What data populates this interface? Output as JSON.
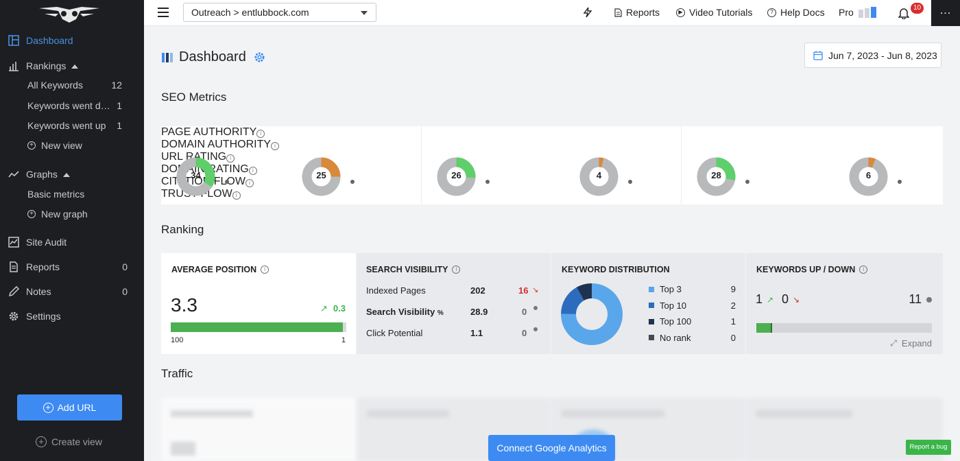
{
  "sidebar": {
    "dashboard": "Dashboard",
    "rankings": "Rankings",
    "rankings_items": [
      {
        "label": "All Keywords",
        "count": "12"
      },
      {
        "label": "Keywords went down",
        "count": "1"
      },
      {
        "label": "Keywords went up",
        "count": "1"
      }
    ],
    "new_view": "New view",
    "graphs": "Graphs",
    "basic_metrics": "Basic metrics",
    "new_graph": "New graph",
    "site_audit": "Site Audit",
    "reports": "Reports",
    "reports_count": "0",
    "notes": "Notes",
    "notes_count": "0",
    "settings": "Settings",
    "add_url": "Add URL",
    "create_view": "Create view"
  },
  "topbar": {
    "project": "Outreach > entlubbock.com",
    "reports": "Reports",
    "video_tutorials": "Video Tutorials",
    "help_docs": "Help Docs",
    "pro": "Pro",
    "notifications": "10",
    "more": "..."
  },
  "page": {
    "title": "Dashboard",
    "date_range": "Jun 7, 2023 - Jun 8, 2023"
  },
  "seo_metrics": {
    "title": "SEO Metrics",
    "items": [
      {
        "label": "PAGE AUTHORITY",
        "value": "34",
        "color": "#5ecf6a"
      },
      {
        "label": "DOMAIN AUTHORITY",
        "value": "25",
        "color": "#d9893a"
      },
      {
        "label": "URL RATING",
        "value": "26",
        "color": "#5ecf6a"
      },
      {
        "label": "DOMAIN RATING",
        "value": "4",
        "color": "#d9893a"
      },
      {
        "label": "CITATION FLOW",
        "value": "28",
        "color": "#5ecf6a"
      },
      {
        "label": "TRUST FLOW",
        "value": "6",
        "color": "#d9893a"
      }
    ]
  },
  "ranking": {
    "title": "Ranking",
    "average_position": {
      "label": "AVERAGE POSITION",
      "value": "3.3",
      "change": "0.3",
      "scale_min": "100",
      "scale_max": "1",
      "fill": 0.98
    },
    "search_visibility": {
      "label": "SEARCH VISIBILITY",
      "rows": [
        {
          "name": "Indexed Pages",
          "value": "202",
          "change": "16"
        },
        {
          "name": "Search Visibility",
          "suffix": "%",
          "value": "28.9",
          "change": "0"
        },
        {
          "name": "Click Potential",
          "value": "1.1",
          "change": "0"
        }
      ]
    },
    "keyword_distribution": {
      "label": "KEYWORD DISTRIBUTION",
      "items": [
        {
          "name": "Top 3",
          "value": "9",
          "color": "#5aa6ea"
        },
        {
          "name": "Top 10",
          "value": "2",
          "color": "#2d6bbd"
        },
        {
          "name": "Top 100",
          "value": "1",
          "color": "#1e3350"
        },
        {
          "name": "No rank",
          "value": "0",
          "color": "#444a52"
        }
      ]
    },
    "keywords_up_down": {
      "label": "KEYWORDS UP / DOWN",
      "up": "1",
      "down": "0",
      "total": "11",
      "expand": "Expand",
      "fill": 0.09
    }
  },
  "traffic": {
    "title": "Traffic",
    "connect": "Connect Google Analytics"
  },
  "report_bug": "Report a bug"
}
